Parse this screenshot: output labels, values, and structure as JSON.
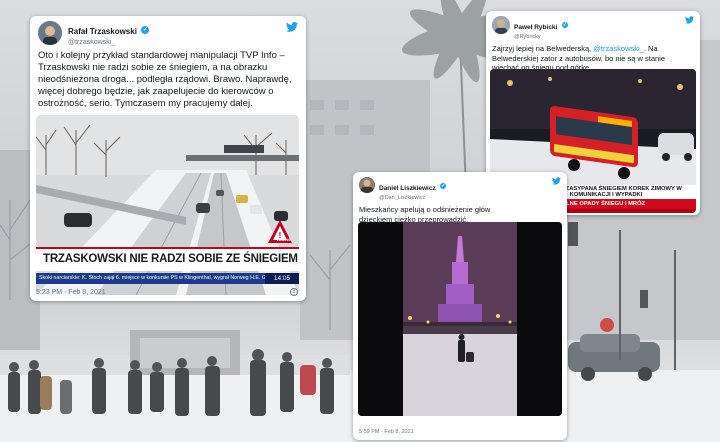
{
  "colors": {
    "twitter_blue": "#1da1f2",
    "mention_blue": "#1b95e0",
    "tv_red": "#c7001b",
    "tv_blue": "#1e3a8a",
    "news_red": "#d00a1e"
  },
  "tweets": [
    {
      "author_name": "Rafał Trzaskowski",
      "author_handle": "@trzaskowski_",
      "text": "Oto i kolejny przykład standardowej manipulacji TVP Info – Trzaskowski nie radzi sobie ze śniegiem, a na obrazku nieodśnieżona droga... podległa rządowi. Brawo. Naprawdę, więcej dobrego będzie, jak zaapelujecie do kierowców o ostrożność, serio. Tymczasem my pracujemy dalej.",
      "timestamp": "5:23 PM · Feb 8, 2021",
      "icons": [
        "verified-badge",
        "twitter-bird-icon",
        "info-icon"
      ],
      "media": {
        "banner": "TRZASKOWSKI NIE RADZI SOBIE ZE ŚNIEGIEM",
        "ticker": "Skoki narciarskie: K. Stoch zajął 6. miejsce w konkursie PŚ w Klingenthal, wygrał Norweg H.E. Granerud",
        "clock": "14:05",
        "logo_text": "WAŻNE"
      }
    },
    {
      "author_name": "Paweł Rybicki",
      "author_handle": "@Rybricky",
      "text_before": "Zajrzyj lepiej na Belwederską, ",
      "mention": "@trzaskowski_",
      "text_after": ". Na Belwederskiej zator z autobusów, bo nie są w stanie wjechać po śniegu pod górkę.",
      "icons": [
        "verified-badge",
        "twitter-bird-icon"
      ],
      "media": {
        "tag": "GODZINY SZCZYTU",
        "headline": "WARSZAWA ZASYPANA ŚNIEGIEM KOREK ZIMOWY W KOMUNIKACJI I WYPADKI",
        "crawl": "ATAK ZIMY W POLSCE: SILNE OPADY ŚNIEGU I MRÓZ",
        "crawl2": "Warszawa: Autobusy"
      }
    },
    {
      "author_name": "Daniel Liszkiewicz",
      "author_handle": "@Dan_Liszkiewicz",
      "text": "Mieszkańcy apelują o odśnieżenie głów",
      "text_line2": "dzieckiem ciężko przeprowadzić.",
      "timestamp": "5:59 PM · Feb 8, 2021",
      "icons": [
        "verified-badge",
        "twitter-bird-icon"
      ]
    }
  ]
}
